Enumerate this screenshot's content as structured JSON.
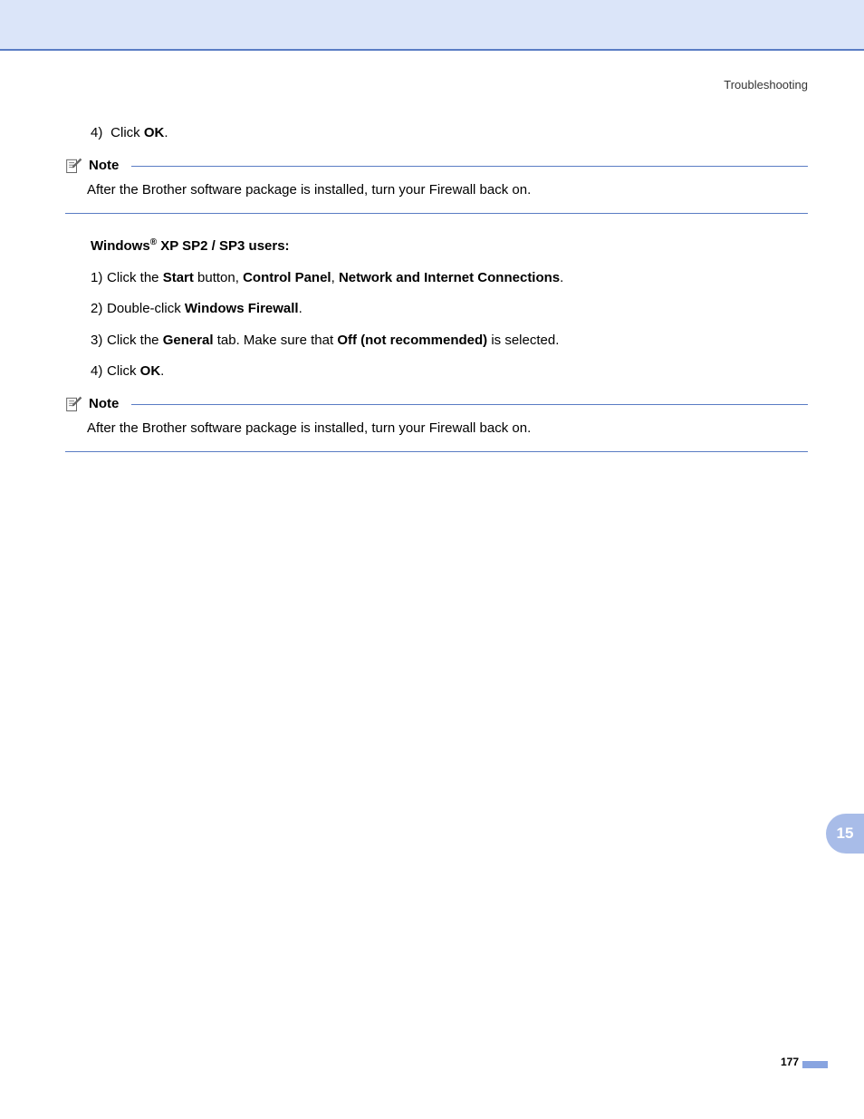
{
  "header": {
    "section_title": "Troubleshooting"
  },
  "top_step": {
    "num": "4)",
    "prefix": "Click ",
    "bold": "OK",
    "suffix": "."
  },
  "note1": {
    "label": "Note",
    "text": "After the Brother software package is installed, turn your Firewall back on."
  },
  "section_heading": {
    "prefix": "Windows",
    "sup": "®",
    "suffix": " XP SP2 / SP3 users:"
  },
  "steps": [
    {
      "num": "1)",
      "parts": [
        {
          "t": "Click the ",
          "b": false
        },
        {
          "t": "Start",
          "b": true
        },
        {
          "t": " button, ",
          "b": false
        },
        {
          "t": "Control Panel",
          "b": true
        },
        {
          "t": ", ",
          "b": false
        },
        {
          "t": "Network and Internet Connections",
          "b": true
        },
        {
          "t": ".",
          "b": false
        }
      ]
    },
    {
      "num": "2)",
      "parts": [
        {
          "t": "Double-click ",
          "b": false
        },
        {
          "t": "Windows Firewall",
          "b": true
        },
        {
          "t": ".",
          "b": false
        }
      ]
    },
    {
      "num": "3)",
      "parts": [
        {
          "t": "Click the ",
          "b": false
        },
        {
          "t": "General",
          "b": true
        },
        {
          "t": " tab. Make sure that ",
          "b": false
        },
        {
          "t": "Off (not recommended)",
          "b": true
        },
        {
          "t": " is selected.",
          "b": false
        }
      ]
    },
    {
      "num": "4)",
      "parts": [
        {
          "t": "Click ",
          "b": false
        },
        {
          "t": "OK",
          "b": true
        },
        {
          "t": ".",
          "b": false
        }
      ]
    }
  ],
  "note2": {
    "label": "Note",
    "text": "After the Brother software package is installed, turn your Firewall back on."
  },
  "chapter_tab": "15",
  "page_number": "177"
}
